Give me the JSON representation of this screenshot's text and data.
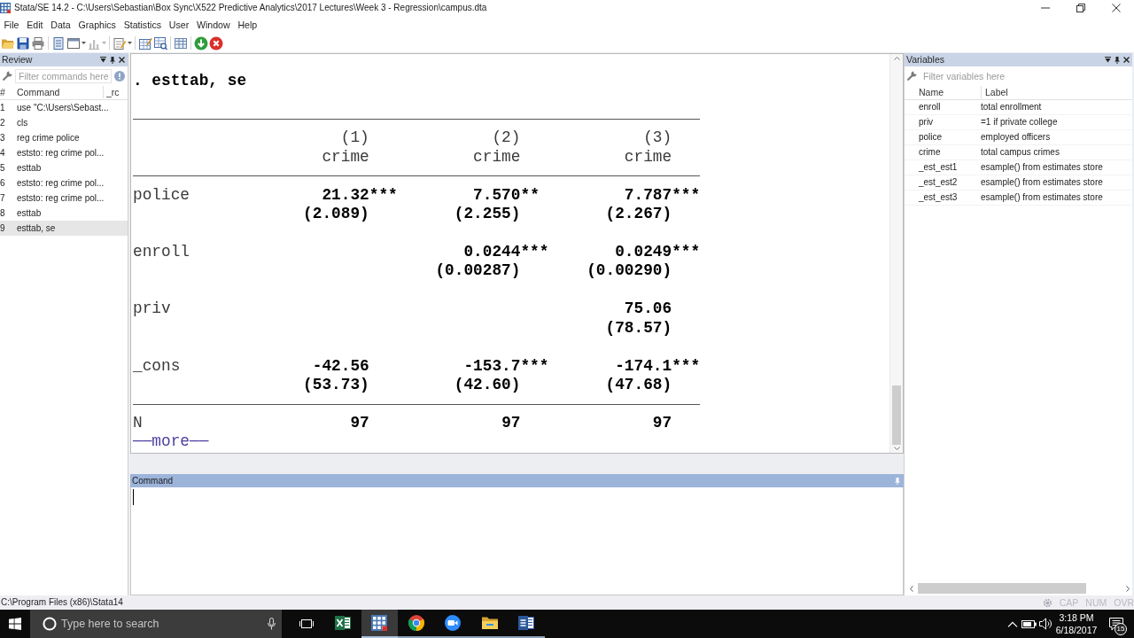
{
  "window": {
    "title": "Stata/SE 14.2 - C:\\Users\\Sebastian\\Box Sync\\X522 Predictive Analytics\\2017 Lectures\\Week 3 - Regression\\campus.dta"
  },
  "menu": [
    "File",
    "Edit",
    "Data",
    "Graphics",
    "Statistics",
    "User",
    "Window",
    "Help"
  ],
  "toolbar": [
    {
      "disabled": false
    },
    {
      "disabled": false
    },
    {
      "disabled": false
    },
    {
      "disabled": false
    },
    {
      "disabled": false
    },
    {
      "disabled": true
    },
    {
      "disabled": false
    },
    {
      "disabled": false
    },
    {
      "disabled": false
    },
    {
      "disabled": false
    },
    {
      "disabled": false
    },
    {
      "disabled": false
    }
  ],
  "review": {
    "title": "Review",
    "filter": {
      "placeholder": "Filter commands here"
    },
    "columns": [
      "#",
      "Command",
      "_rc"
    ],
    "rows": [
      {
        "number": "1",
        "command": "use \"C:\\Users\\Sebast...",
        "selected": false
      },
      {
        "number": "2",
        "command": "cls",
        "selected": false
      },
      {
        "number": "3",
        "command": "reg crime police",
        "selected": false
      },
      {
        "number": "4",
        "command": "eststo: reg crime pol...",
        "selected": false
      },
      {
        "number": "5",
        "command": "esttab",
        "selected": false
      },
      {
        "number": "6",
        "command": "eststo: reg crime pol...",
        "selected": false
      },
      {
        "number": "7",
        "command": "eststo: reg crime pol...",
        "selected": false
      },
      {
        "number": "8",
        "command": "esttab",
        "selected": false
      },
      {
        "number": "9",
        "command": "esttab, se",
        "selected": true
      }
    ]
  },
  "results": {
    "command": ". esttab, se",
    "models": [
      {
        "number": "(1)",
        "depvar": "crime"
      },
      {
        "number": "(2)",
        "depvar": "crime"
      },
      {
        "number": "(3)",
        "depvar": "crime"
      }
    ],
    "rows": [
      {
        "label": "police",
        "cells": [
          {
            "coef": "21.32***",
            "se": "(2.089)"
          },
          {
            "coef": "7.570**",
            "se": "(2.255)"
          },
          {
            "coef": "7.787***",
            "se": "(2.267)"
          }
        ]
      },
      {
        "label": "enroll",
        "cells": [
          null,
          {
            "coef": "0.0244***",
            "se": "(0.00287)"
          },
          {
            "coef": "0.0249***",
            "se": "(0.00290)"
          }
        ]
      },
      {
        "label": "priv",
        "cells": [
          null,
          null,
          {
            "coef": "75.06",
            "se": "(78.57)"
          }
        ]
      },
      {
        "label": "_cons",
        "cells": [
          {
            "coef": "-42.56",
            "se": "(53.73)"
          },
          {
            "coef": "-153.7***",
            "se": "(42.60)"
          },
          {
            "coef": "-174.1***",
            "se": "(47.68)"
          }
        ]
      }
    ],
    "stats": [
      {
        "label": "N",
        "values": [
          "97",
          "97",
          "97"
        ]
      }
    ],
    "more": "──more──"
  },
  "command_window": {
    "title": "Command",
    "focused": true
  },
  "variables": {
    "title": "Variables",
    "filter": {
      "placeholder": "Filter variables here"
    },
    "columns": [
      "Name",
      "Label"
    ],
    "rows": [
      {
        "name": "enroll",
        "label": "total enrollment"
      },
      {
        "name": "priv",
        "label": "=1 if private college"
      },
      {
        "name": "police",
        "label": "employed officers"
      },
      {
        "name": "crime",
        "label": "total campus crimes"
      },
      {
        "name": "_est_est1",
        "label": "esample() from estimates store"
      },
      {
        "name": "_est_est2",
        "label": "esample() from estimates store"
      },
      {
        "name": "_est_est3",
        "label": "esample() from estimates store"
      }
    ]
  },
  "status_bar": {
    "path": "C:\\Program Files (x86)\\Stata14",
    "indicators": [
      {
        "label": "CAP",
        "on": false
      },
      {
        "label": "NUM",
        "on": false
      },
      {
        "label": "OVR",
        "on": false
      }
    ]
  },
  "taskbar": {
    "search": {
      "placeholder": "Type here to search"
    },
    "apps": [
      {
        "running": false,
        "selected": false
      },
      {
        "running": true,
        "selected": true
      },
      {
        "running": true,
        "selected": false
      },
      {
        "running": true,
        "selected": false
      },
      {
        "running": true,
        "selected": false
      },
      {
        "running": true,
        "selected": false
      }
    ],
    "clock": {
      "time": "3:18 PM",
      "date": "6/18/2017"
    },
    "notifications": {
      "count": "15"
    }
  }
}
